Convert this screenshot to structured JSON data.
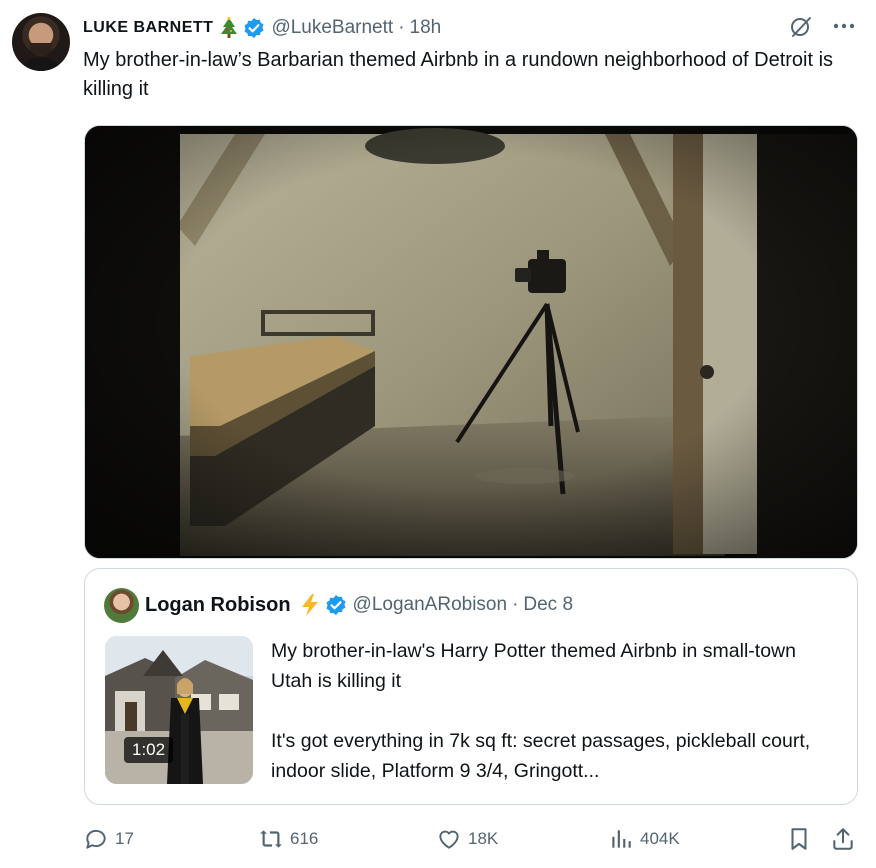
{
  "author": {
    "name": "LUKE BARNETT",
    "handle": "@LukeBarnett",
    "separator": "·",
    "time": "18h"
  },
  "tweet": {
    "text": "My brother-in-law’s Barbarian themed Airbnb in a rundown neighborhood of Detroit is killing it"
  },
  "quote": {
    "name": "Logan Robison",
    "handle": "@LoganARobison",
    "separator": "·",
    "date": "Dec 8",
    "video_duration": "1:02",
    "text": "My brother-in-law's Harry Potter themed Airbnb in small-town Utah is killing it\n\nIt's got everything in 7k sq ft: secret passages, pickleball court, indoor slide, Platform 9 3/4, Gringott..."
  },
  "actions": {
    "replies": "17",
    "reposts": "616",
    "likes": "18K",
    "views": "404K"
  },
  "icons": [
    "avatar",
    "tree-icon",
    "verified-badge-icon",
    "grok-icon",
    "more-icon",
    "bolt-icon",
    "reply-icon",
    "repost-icon",
    "like-icon",
    "views-icon",
    "bookmark-icon",
    "share-icon"
  ],
  "colors": {
    "verified": "#1d9bf0",
    "secondary_text": "#536471",
    "bolt": "#f7b928",
    "border": "#cfd9de"
  }
}
